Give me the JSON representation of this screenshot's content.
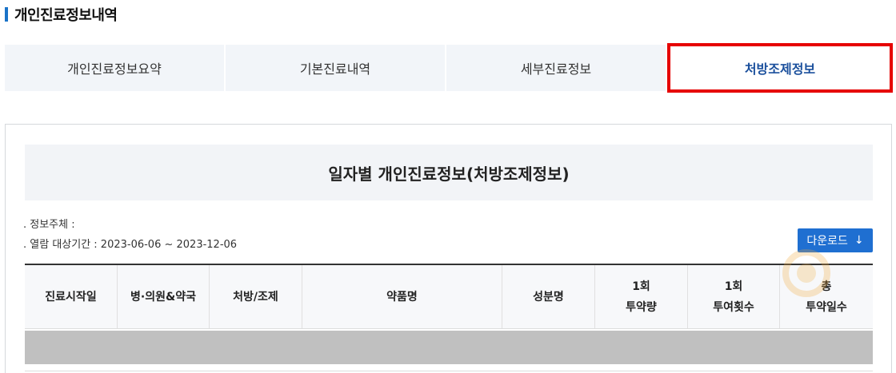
{
  "page": {
    "title": "개인진료정보내역"
  },
  "tabs": [
    {
      "label": "개인진료정보요약"
    },
    {
      "label": "기본진료내역"
    },
    {
      "label": "세부진료정보"
    },
    {
      "label": "처방조제정보"
    }
  ],
  "active_tab": "처방조제정보",
  "document": {
    "title": "일자별 개인진료정보(처방조제정보)",
    "subject_label": ". 정보주체 :",
    "period_label": ". 열람 대상기간 : 2023-06-06 ~ 2023-12-06"
  },
  "download": {
    "label": "다운로드",
    "icon": "arrow-down-icon"
  },
  "table": {
    "headers": [
      [
        "진료시작일"
      ],
      [
        "병·의원&약국"
      ],
      [
        "처방/조제"
      ],
      [
        "약품명"
      ],
      [
        "성분명"
      ],
      [
        "1회",
        "투약량"
      ],
      [
        "1회",
        "투여횟수"
      ],
      [
        "총",
        "투약일수"
      ]
    ]
  },
  "colors": {
    "accent": "#1f6fd1",
    "active_tab_text": "#1a4f9c",
    "highlight_border": "#e60000",
    "redacted": "#c0c0c0"
  }
}
